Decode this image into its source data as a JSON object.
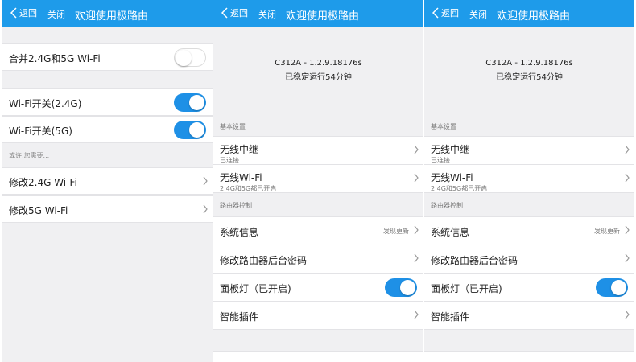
{
  "panel1": {
    "back": "返回",
    "close": "关闭",
    "title": "欢迎使用极路由",
    "merge_label": "合并2.4G和5G Wi-Fi",
    "wifi24_label": "Wi-Fi开关(2.4G)",
    "wifi5_label": "Wi-Fi开关(5G)",
    "hint": "或许,您需要...",
    "edit24_label": "修改2.4G Wi-Fi",
    "edit5_label": "修改5G Wi-Fi"
  },
  "panel2": {
    "back": "返回",
    "close": "关闭",
    "title": "欢迎使用极路由",
    "version": "C312A - 1.2.9.18176s",
    "uptime": "已稳定运行54分钟",
    "section_basic": "基本设置",
    "relay_label": "无线中继",
    "relay_sub": "已连接",
    "wifi_label": "无线Wi-Fi",
    "wifi_sub": "2.4G和5G都已开启",
    "section_control": "路由器控制",
    "sysinfo_label": "系统信息",
    "sysinfo_right": "发现更新",
    "password_label": "修改路由器后台密码",
    "led_label": "面板灯（已开启)",
    "plugin_label": "智能插件"
  },
  "panel3": {
    "back": "返回",
    "close": "关闭",
    "title": "欢迎使用极路由",
    "version": "C312A - 1.2.9.18176s",
    "uptime": "已稳定运行54分钟",
    "section_basic": "基本设置",
    "relay_label": "无线中继",
    "relay_sub": "已连接",
    "wifi_label": "无线Wi-Fi",
    "wifi_sub": "2.4G和5G都已开启",
    "section_control": "路由器控制",
    "sysinfo_label": "系统信息",
    "sysinfo_right": "发现更新",
    "password_label": "修改路由器后台密码",
    "led_label": "面板灯（已开启)",
    "plugin_label": "智能插件"
  },
  "toggles": {
    "merge": false,
    "wifi24": true,
    "wifi5": true,
    "led": true
  },
  "colors": {
    "header": "#1e9bea",
    "toggle_on": "#1e90e6",
    "background": "#f0f0f2"
  },
  "icons": [
    "back-arrow-icon",
    "chevron-right-icon"
  ]
}
